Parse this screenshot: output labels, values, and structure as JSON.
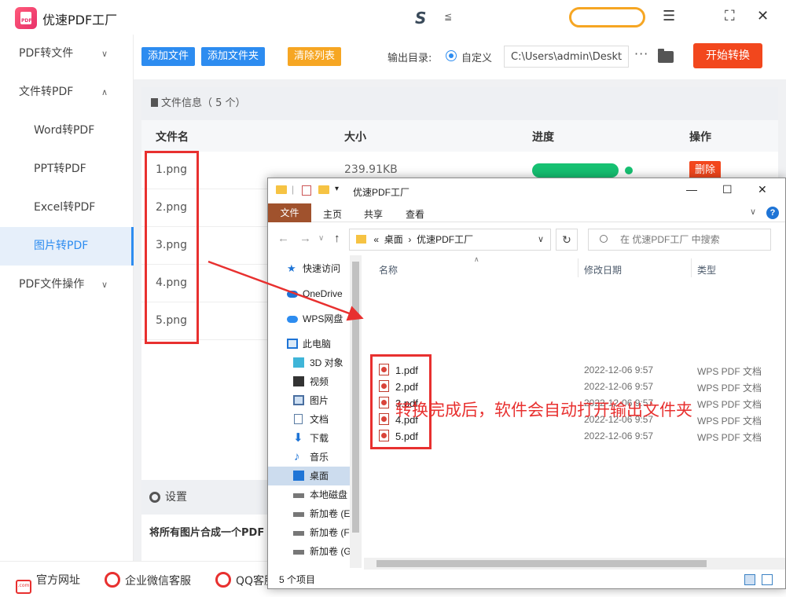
{
  "app": {
    "title": "优速PDF工厂",
    "logo_tag": "PDF"
  },
  "sidebar": {
    "items": [
      {
        "label": "PDF转文件",
        "chevron": "∨"
      },
      {
        "label": "文件转PDF",
        "chevron": "∧"
      },
      {
        "label": "Word转PDF"
      },
      {
        "label": "PPT转PDF"
      },
      {
        "label": "Excel转PDF"
      },
      {
        "label": "图片转PDF"
      },
      {
        "label": "PDF文件操作",
        "chevron": "∨"
      }
    ]
  },
  "toolbar": {
    "add_file": "添加文件",
    "add_folder": "添加文件夹",
    "clear_list": "清除列表",
    "output_label": "输出目录:",
    "custom_label": "自定义",
    "output_path": "C:\\Users\\admin\\Deskto",
    "more": "···",
    "start": "开始转换"
  },
  "file_panel": {
    "header": "文件信息（ 5 个）",
    "columns": {
      "name": "文件名",
      "size": "大小",
      "progress": "进度",
      "action": "操作"
    },
    "rows": [
      {
        "name": "1.png",
        "size": "239.91KB",
        "progress": 1.0,
        "action": "删除"
      },
      {
        "name": "2.png"
      },
      {
        "name": "3.png"
      },
      {
        "name": "4.png"
      },
      {
        "name": "5.png"
      }
    ]
  },
  "settings": {
    "title": "设置",
    "merge_label": "将所有图片合成一个PDF"
  },
  "footer": {
    "website": "官方网址",
    "wechat": "企业微信客服",
    "qq": "QQ客服",
    "com_tag": ".com"
  },
  "explorer": {
    "title": "优速PDF工厂",
    "ribbon": {
      "file": "文件",
      "home": "主页",
      "share": "共享",
      "view": "查看",
      "help": "?"
    },
    "address": {
      "prefix": "«",
      "part1": "桌面",
      "sep": "›",
      "part2": "优速PDF工厂"
    },
    "search_placeholder": "在 优速PDF工厂 中搜索",
    "nav": [
      {
        "label": "快速访问",
        "icon": "star-icon"
      },
      {
        "label": "OneDrive",
        "icon": "cloud-icon"
      },
      {
        "label": "WPS网盘",
        "icon": "cloud-icon"
      },
      {
        "label": "此电脑",
        "icon": "computer-icon"
      },
      {
        "label": "3D 对象",
        "icon": "cube-icon"
      },
      {
        "label": "视频",
        "icon": "video-icon"
      },
      {
        "label": "图片",
        "icon": "image-icon"
      },
      {
        "label": "文档",
        "icon": "document-icon"
      },
      {
        "label": "下载",
        "icon": "download-icon"
      },
      {
        "label": "音乐",
        "icon": "music-icon"
      },
      {
        "label": "桌面",
        "icon": "desktop-icon"
      },
      {
        "label": "本地磁盘",
        "icon": "drive-icon"
      },
      {
        "label": "新加卷 (E",
        "icon": "drive-icon"
      },
      {
        "label": "新加卷 (F",
        "icon": "drive-icon"
      },
      {
        "label": "新加卷 (G",
        "icon": "drive-icon"
      }
    ],
    "columns": {
      "name": "名称",
      "date": "修改日期",
      "type": "类型"
    },
    "files": [
      {
        "name": "1.pdf",
        "date": "2022-12-06 9:57",
        "type": "WPS PDF 文档"
      },
      {
        "name": "2.pdf",
        "date": "2022-12-06 9:57",
        "type": "WPS PDF 文档"
      },
      {
        "name": "3.pdf",
        "date": "2022-12-06 9:57",
        "type": "WPS PDF 文档"
      },
      {
        "name": "4.pdf",
        "date": "2022-12-06 9:57",
        "type": "WPS PDF 文档"
      },
      {
        "name": "5.pdf",
        "date": "2022-12-06 9:57",
        "type": "WPS PDF 文档"
      }
    ],
    "status": "5 个项目"
  },
  "annotation": {
    "caption": "转换完成后，软件会自动打开输出文件夹",
    "color": "#e8302f"
  },
  "colors": {
    "accent_blue": "#2d8cf0",
    "accent_orange": "#f6a623",
    "accent_red": "#f2471d",
    "success_green": "#16c172"
  }
}
